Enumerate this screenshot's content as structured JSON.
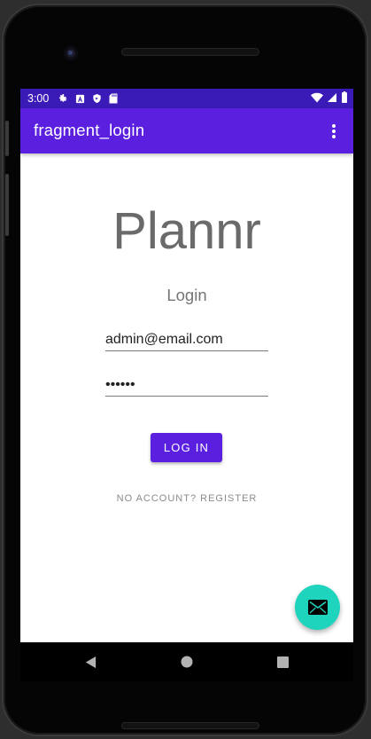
{
  "status_bar": {
    "time": "3:00",
    "left_icons": [
      "gear-icon",
      "a-icon",
      "shield-icon",
      "sd-card-icon"
    ],
    "right_icons": [
      "wifi-icon",
      "signal-icon",
      "battery-icon"
    ]
  },
  "app_bar": {
    "title": "fragment_login",
    "overflow_icon": "more-vert-icon"
  },
  "login": {
    "logo": "Plannr",
    "subtitle": "Login",
    "email_value": "admin@email.com",
    "password_value": "••••••",
    "login_button_label": "LOG IN",
    "register_link_label": "NO ACCOUNT? REGISTER"
  },
  "fab": {
    "icon": "mail-icon"
  },
  "nav_bar": {
    "buttons": [
      "back-icon",
      "home-icon",
      "recents-icon"
    ]
  },
  "colors": {
    "status_bar": "#3b1bb7",
    "app_bar": "#5b1fe0",
    "primary_button": "#5b1fe0",
    "fab": "#1fd4bd",
    "logo_text": "#6a6a6a"
  }
}
